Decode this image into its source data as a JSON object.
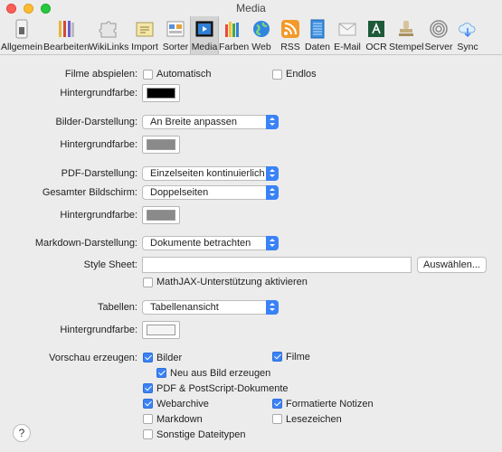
{
  "window": {
    "title": "Media"
  },
  "toolbar": {
    "items": [
      {
        "label": "Allgemein",
        "icon": "switch-icon"
      },
      {
        "label": "Bearbeiten",
        "icon": "pencils-icon"
      },
      {
        "label": "WikiLinks",
        "icon": "puzzle-icon"
      },
      {
        "label": "Import",
        "icon": "import-icon"
      },
      {
        "label": "Sorter",
        "icon": "sorter-icon"
      },
      {
        "label": "Media",
        "icon": "media-icon"
      },
      {
        "label": "Farben",
        "icon": "crayons-icon"
      },
      {
        "label": "Web",
        "icon": "globe-icon"
      },
      {
        "label": "RSS",
        "icon": "rss-icon"
      },
      {
        "label": "Daten",
        "icon": "data-icon"
      },
      {
        "label": "E-Mail",
        "icon": "envelope-icon"
      },
      {
        "label": "OCR",
        "icon": "ocr-icon"
      },
      {
        "label": "Stempel",
        "icon": "stamp-icon"
      },
      {
        "label": "Server",
        "icon": "server-icon"
      },
      {
        "label": "Sync",
        "icon": "cloud-sync-icon"
      }
    ],
    "selected": "Media",
    "accent": "#3a82f7"
  },
  "filme": {
    "label": "Filme abspielen:",
    "automatisch": {
      "label": "Automatisch",
      "checked": false
    },
    "endlos": {
      "label": "Endlos",
      "checked": false
    },
    "bg_label": "Hintergrundfarbe:",
    "bg_color": "#000000"
  },
  "bilder": {
    "label": "Bilder-Darstellung:",
    "value": "An Breite anpassen",
    "bg_label": "Hintergrundfarbe:",
    "bg_color": "#8a8a8a"
  },
  "pdf": {
    "label": "PDF-Darstellung:",
    "value": "Einzelseiten kontinuierlich",
    "fullscreen_label": "Gesamter Bildschirm:",
    "fullscreen_value": "Doppelseiten",
    "bg_label": "Hintergrundfarbe:",
    "bg_color": "#8a8a8a"
  },
  "markdown": {
    "label": "Markdown-Darstellung:",
    "value": "Dokumente betrachten",
    "stylesheet_label": "Style Sheet:",
    "stylesheet_value": "",
    "choose_button": "Auswählen...",
    "mathjax": {
      "label": "MathJAX-Unterstützung aktivieren",
      "checked": false
    }
  },
  "tabellen": {
    "label": "Tabellen:",
    "value": "Tabellenansicht",
    "bg_label": "Hintergrundfarbe:",
    "bg_color": "#f4f4f4"
  },
  "vorschau": {
    "label": "Vorschau erzeugen:",
    "bilder": {
      "label": "Bilder",
      "checked": true
    },
    "filme": {
      "label": "Filme",
      "checked": true
    },
    "neu_aus_bild": {
      "label": "Neu aus Bild erzeugen",
      "checked": true
    },
    "pdf_postscript": {
      "label": "PDF & PostScript-Dokumente",
      "checked": true
    },
    "webarchive": {
      "label": "Webarchive",
      "checked": true
    },
    "formatierte_notizen": {
      "label": "Formatierte Notizen",
      "checked": true
    },
    "markdown": {
      "label": "Markdown",
      "checked": false
    },
    "lesezeichen": {
      "label": "Lesezeichen",
      "checked": false
    },
    "sonstige": {
      "label": "Sonstige Dateitypen",
      "checked": false
    }
  },
  "help": {
    "label": "?"
  }
}
